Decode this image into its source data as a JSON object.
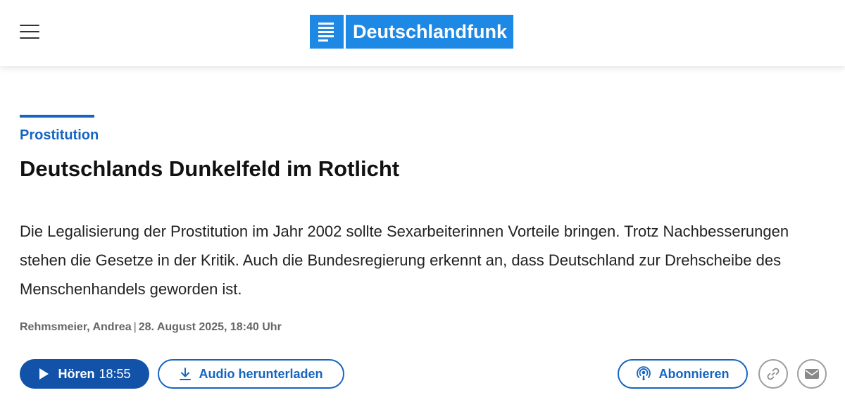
{
  "header": {
    "brand": "Deutschlandfunk",
    "brand_color": "#1e88e5",
    "icons": {
      "menu": "hamburger-menu-icon",
      "logo": "deutschlandfunk-logo-icon"
    }
  },
  "article": {
    "kicker": "Prostitution",
    "title": "Deutschlands Dunkelfeld im Rotlicht",
    "teaser": "Die Legalisierung der Prostitution im Jahr 2002 sollte Sexarbeiterinnen Vorteile bringen. Trotz Nachbesserungen stehen die Gesetze in der Kritik. Auch die Bundesregierung erkennt an, dass Deutschland zur Drehscheibe des Menschenhandels geworden ist.",
    "author": "Rehmsmeier, Andrea",
    "separator": "|",
    "date": "28. August 2025, 18:40 Uhr",
    "accent_color": "#1565c0"
  },
  "actions": {
    "play_label": "Hören",
    "play_duration": "18:55",
    "download_label": "Audio herunterladen",
    "subscribe_label": "Abonnieren",
    "icons": {
      "play": "play-icon",
      "download": "download-icon",
      "podcast": "podcast-icon",
      "link": "link-icon",
      "mail": "mail-icon"
    }
  }
}
